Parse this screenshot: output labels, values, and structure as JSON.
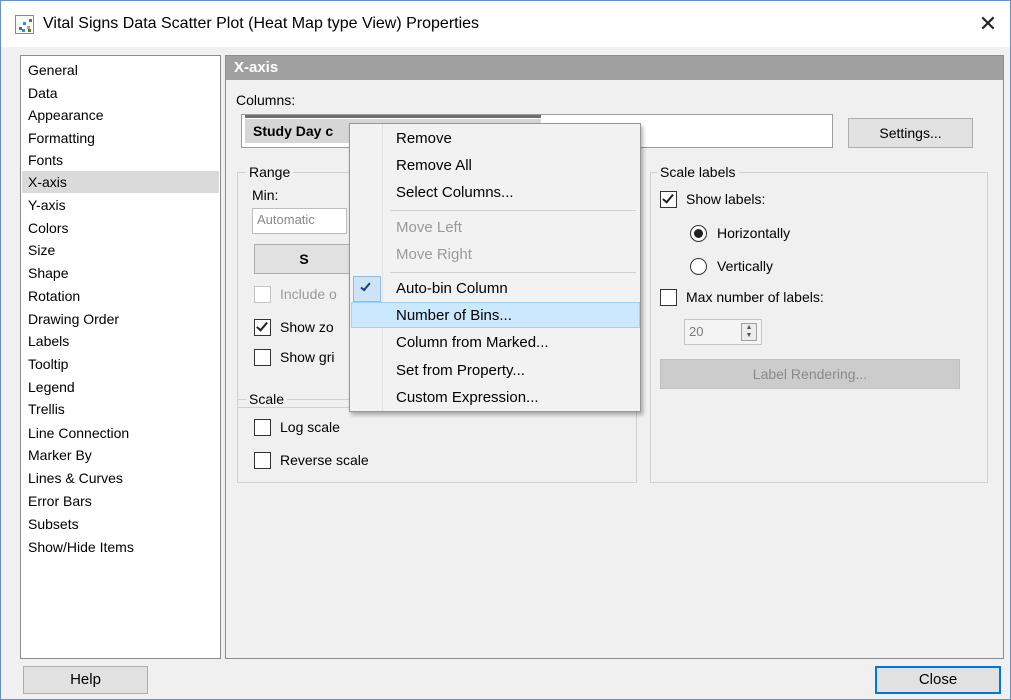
{
  "window": {
    "title": "Vital Signs Data Scatter Plot (Heat Map type View) Properties",
    "close_glyph": "✕"
  },
  "nav": {
    "items": [
      "General",
      "Data",
      "Appearance",
      "Formatting",
      "Fonts",
      "X-axis",
      "Y-axis",
      "Colors",
      "Size",
      "Shape",
      "Rotation",
      "Drawing Order",
      "Labels",
      "Tooltip",
      "Legend",
      "Trellis",
      "Line Connection",
      "Marker By",
      "Lines & Curves",
      "Error Bars",
      "Subsets",
      "Show/Hide Items"
    ],
    "selected": "X-axis"
  },
  "panel": {
    "header": "X-axis",
    "columns_label": "Columns:",
    "column_chip": "Study Day c",
    "settings_button": "Settings...",
    "range": {
      "title": "Range",
      "min_label": "Min:",
      "min_value": "Automatic",
      "set_button": "S",
      "include_label": "Include o",
      "show_zoom_label": "Show zo",
      "show_grid_label": "Show gri"
    },
    "scale": {
      "title": "Scale",
      "log_label": "Log scale",
      "reverse_label": "Reverse scale"
    },
    "scale_labels": {
      "title": "Scale labels",
      "show_labels": "Show labels:",
      "horizontally": "Horizontally",
      "vertically": "Vertically",
      "max_labels": "Max number of labels:",
      "max_value": "20",
      "label_rendering": "Label Rendering..."
    }
  },
  "context_menu": {
    "items": {
      "remove": "Remove",
      "remove_all": "Remove All",
      "select_columns": "Select Columns...",
      "move_left": "Move Left",
      "move_right": "Move Right",
      "auto_bin": "Auto-bin Column",
      "number_of_bins": "Number of Bins...",
      "column_from_marked": "Column from Marked...",
      "set_from_property": "Set from Property...",
      "custom_expression": "Custom Expression..."
    }
  },
  "footer": {
    "help": "Help",
    "close": "Close"
  },
  "colors": {
    "header_bg": "#a0a0a0",
    "menu_highlight": "#cce8ff",
    "accent": "#0078d7"
  }
}
